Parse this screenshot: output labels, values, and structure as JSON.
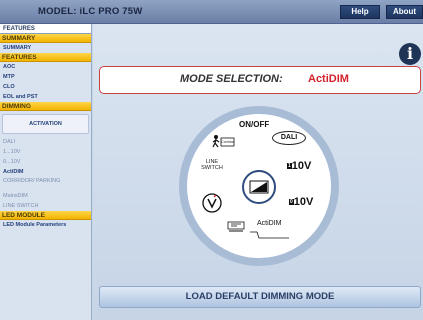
{
  "app": {
    "title": "MODEL: iLC PRO 75W",
    "help_label": "Help",
    "about_label": "About"
  },
  "sidebar": {
    "tab_label": "FEATURES",
    "summary_header": "SUMMARY",
    "summary_item": "SUMMARY",
    "features_header": "FEATURES",
    "features_items": [
      "AOC",
      "MTP",
      "CLO",
      "EOL and PST"
    ],
    "dimming_header": "DIMMING",
    "activation_label": "ACTIVATION",
    "dimming_items": [
      "DALI",
      "1...10V",
      "0...10V",
      "ActiDIM",
      "CORRIDOR/ PARKING",
      "MainsDIM",
      "LINE SWITCH"
    ],
    "active_dimming_item": "ActiDIM",
    "led_header": "LED MODULE",
    "led_item": "LED Module Parameters"
  },
  "main": {
    "mode_label": "MODE SELECTION:",
    "mode_value": "ActiDIM",
    "dial": {
      "top_label": "ON/OFF",
      "dali_label": "DALI",
      "v10_right": "10V",
      "v10_right_prefix": "1",
      "v10_lower": "10V",
      "v10_lower_prefix": "0",
      "line_switch_label": "LINE SWITCH",
      "actidim_label": "ActiDIM",
      "corridor_label": "Corridor"
    },
    "load_default_label": "LOAD DEFAULT DIMMING MODE"
  },
  "colors": {
    "accent_red": "#d2232a",
    "section_yellow": "#f2b400",
    "title_blue": "#1f3557"
  }
}
